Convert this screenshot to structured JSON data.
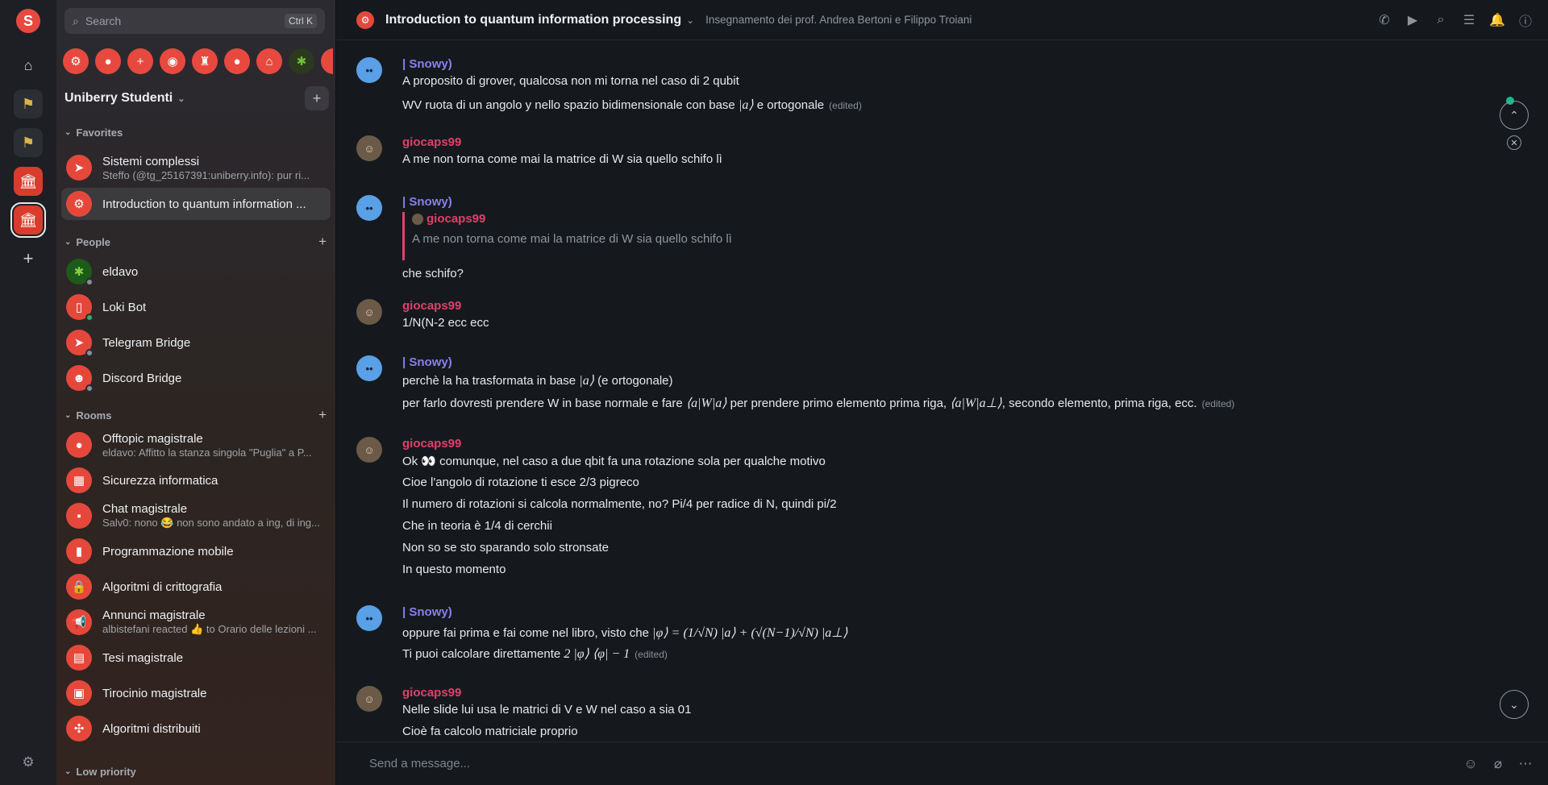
{
  "spaces": {
    "logo": "S"
  },
  "search": {
    "placeholder": "Search",
    "shortcut": "Ctrl K"
  },
  "space": {
    "title": "Uniberry Studenti"
  },
  "sections": {
    "favorites": "Favorites",
    "people": "People",
    "rooms": "Rooms",
    "low_priority": "Low priority"
  },
  "favorites": [
    {
      "name": "Sistemi complessi",
      "sub": "Steffo (@tg_25167391:uniberry.info): pur ri..."
    },
    {
      "name": "Introduction to quantum information ...",
      "sub": ""
    }
  ],
  "people": [
    {
      "name": "eldavo"
    },
    {
      "name": "Loki Bot"
    },
    {
      "name": "Telegram Bridge"
    },
    {
      "name": "Discord Bridge"
    }
  ],
  "rooms": [
    {
      "name": "Offtopic magistrale",
      "sub": "eldavo: Affitto la stanza singola \"Puglia\" a P..."
    },
    {
      "name": "Sicurezza informatica",
      "sub": ""
    },
    {
      "name": "Chat magistrale",
      "sub": "Salv0: nono 😂 non sono andato a ing, di ing..."
    },
    {
      "name": "Programmazione mobile",
      "sub": ""
    },
    {
      "name": "Algoritmi di crittografia",
      "sub": ""
    },
    {
      "name": "Annunci magistrale",
      "sub": "albistefani reacted 👍 to Orario delle lezioni ..."
    },
    {
      "name": "Tesi magistrale",
      "sub": ""
    },
    {
      "name": "Tirocinio magistrale",
      "sub": ""
    },
    {
      "name": "Algoritmi distribuiti",
      "sub": ""
    }
  ],
  "header": {
    "title": "Introduction to quantum information processing",
    "topic": "Insegnamento dei prof. Andrea Bertoni e Filippo Troiani"
  },
  "messages": {
    "m1": {
      "sender": "| Snowy)",
      "l1": "A proposito di grover, qualcosa non mi torna nel caso di 2 qubit",
      "l2a": "WV ruota di un angolo y nello spazio bidimensionale con base ",
      "l2m": "|a⟩",
      "l2b": " e ortogonale",
      "edited": "(edited)"
    },
    "m2": {
      "sender": "giocaps99",
      "l1": "A me non torna come mai la matrice di W sia quello schifo lì"
    },
    "m3": {
      "sender": "| Snowy)",
      "qsender": "giocaps99",
      "qbody": "A me non torna come mai la matrice di W sia quello schifo lì",
      "l1": "che schifo?"
    },
    "m4": {
      "sender": "giocaps99",
      "l1": "1/N(N-2 ecc ecc"
    },
    "m5": {
      "sender": "| Snowy)",
      "l1a": "perchè la ha trasformata in base ",
      "l1m": "|a⟩",
      "l1b": " (e ortogonale)",
      "l2a": "per farlo dovresti prendere W in base normale e fare ",
      "l2m1": "⟨a|W|a⟩",
      "l2b": " per prendere primo elemento prima riga, ",
      "l2m2": "⟨a|W|a⊥⟩",
      "l2c": ", secondo elemento, prima riga, ecc.",
      "edited": "(edited)"
    },
    "m6": {
      "sender": "giocaps99",
      "l1": "Ok 👀 comunque, nel caso a due qbit fa una rotazione sola per qualche motivo",
      "l2": "Cioe l'angolo di rotazione ti esce 2/3 pigreco",
      "l3": "Il numero di rotazioni si calcola normalmente, no? Pi/4 per radice di N, quindi pi/2",
      "l4": "Che in teoria è 1/4 di cerchii",
      "l5": "Non so se sto sparando solo stronsate",
      "l6": "In questo momento"
    },
    "m7": {
      "sender": "| Snowy)",
      "l1a": "oppure fai prima e fai come nel libro, visto che ",
      "l1m": "|φ⟩ = (1/√N) |a⟩ + (√(N−1)/√N) |a⊥⟩",
      "l2a": "Ti puoi calcolare direttamente ",
      "l2m": "2 |φ⟩ ⟨φ| − 1",
      "edited": "(edited)"
    },
    "m8": {
      "sender": "giocaps99",
      "l1": "Nelle slide lui usa le matrici di V e W nel caso a sia 01",
      "l2": "Cioè fa calcolo matriciale proprio"
    }
  },
  "composer": {
    "placeholder": "Send a message..."
  },
  "colors": {
    "accent": "#e8493f",
    "snowy": "#8b7ff0",
    "gio": "#e0406a",
    "bg": "#15191e"
  }
}
